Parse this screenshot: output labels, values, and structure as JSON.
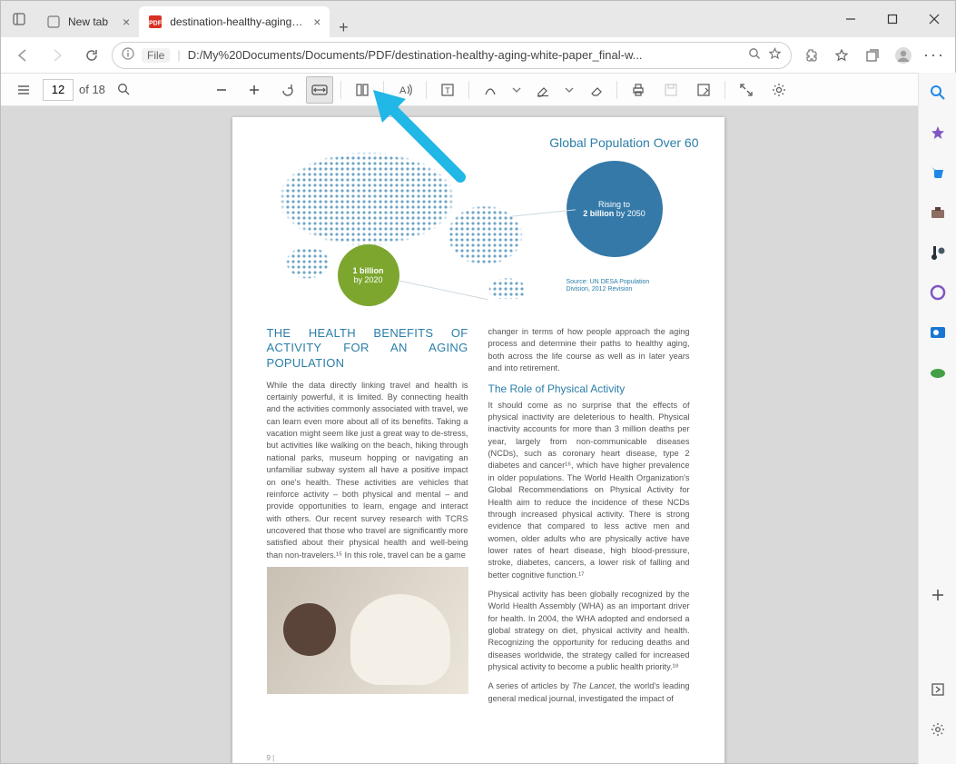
{
  "tabs": {
    "inactive": {
      "label": "New tab"
    },
    "active": {
      "label": "destination-healthy-aging-white"
    }
  },
  "url": {
    "scheme_chip": "File",
    "path": "D:/My%20Documents/Documents/PDF/destination-healthy-aging-white-paper_final-w..."
  },
  "pdf_toolbar": {
    "page_current": "12",
    "page_total": "of 18"
  },
  "doc": {
    "global_heading": "Global Population Over 60",
    "green_top": "1 billion",
    "green_bottom": "by 2020",
    "blue_top": "Rising to",
    "blue_mid": "2 billion",
    "blue_suffix": " by 2050",
    "source": "Source: UN DESA Population Division, 2012 Revision",
    "left_heading": "THE HEALTH BENEFITS OF ACTIVITY FOR AN AGING POPULATION",
    "left_body": "While the data directly linking travel and health is certainly powerful, it is limited. By connecting health and the activities commonly associated with travel, we can learn even more about all of its benefits. Taking a vacation might seem like just a great way to de-stress, but activities like walking on the beach, hiking through national parks, museum hopping or navigating an unfamiliar subway system all have a positive impact on one's health. These activities are vehicles that reinforce activity – both physical and mental – and provide opportunities to learn, engage and interact with others. Our recent survey research with TCRS uncovered that those who travel are significantly more satisfied about their physical health and well-being than non-travelers.¹⁵ In this role, travel can be a game",
    "right_intro": "changer in terms of how people approach the aging process and determine their paths to healthy aging, both across the life course as well as in later years and into retirement.",
    "right_subhead": "The Role of Physical Activity",
    "right_body1": "It should come as no surprise that the effects of physical inactivity are deleterious to health. Physical inactivity accounts for more than 3 million deaths per year, largely from non-communicable diseases (NCDs), such as coronary heart disease, type 2 diabetes and cancer¹⁶, which have higher prevalence in older populations. The World Health Organization's Global Recommendations on Physical Activity for Health aim to reduce the incidence of these NCDs through increased physical activity. There is strong evidence that compared to less active men and women, older adults who are physically active have lower rates of heart disease, high blood-pressure, stroke, diabetes, cancers, a lower risk of falling and better cognitive function.¹⁷",
    "right_body2": "Physical activity has been globally recognized by the World Health Assembly (WHA) as an important driver for health. In 2004, the WHA adopted and endorsed a global strategy on diet, physical activity and health. Recognizing the opportunity for reducing deaths and diseases worldwide, the strategy called for increased physical activity to become a public health priority.¹⁸",
    "right_body3_prefix": "A series of articles by ",
    "right_body3_em": "The Lancet",
    "right_body3_suffix": ", the world's leading general medical journal, investigated the impact of",
    "page_number": "9  |"
  },
  "siderail": {
    "items": [
      "search",
      "copilot",
      "shopping",
      "tools",
      "games",
      "office",
      "outlook",
      "onedrive"
    ]
  }
}
